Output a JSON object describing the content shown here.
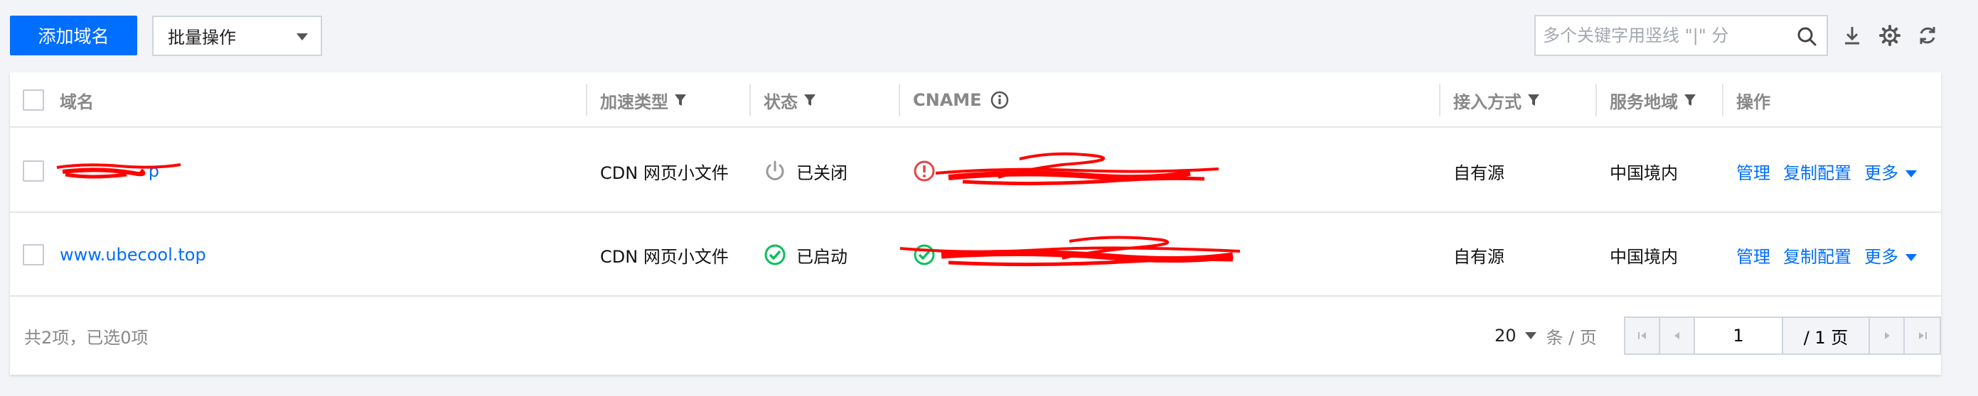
{
  "toolbar": {
    "add_domain_label": "添加域名",
    "batch_label": "批量操作",
    "search_placeholder": "多个关键字用竖线 \"|\" 分",
    "icons": [
      "download-icon",
      "gear-icon",
      "refresh-icon"
    ]
  },
  "table": {
    "columns": [
      "域名",
      "加速类型",
      "状态",
      "CNAME",
      "接入方式",
      "服务地域",
      "操作"
    ],
    "filterable_columns": [
      "加速类型",
      "状态",
      "接入方式",
      "服务地域"
    ],
    "rows": [
      {
        "domain": "",
        "domain_visible_suffix": "p",
        "type": "CDN 网页小文件",
        "status": "已关闭",
        "status_icon": "power-off-icon",
        "cname_icon": "alert-circle-icon",
        "access": "自有源",
        "region": "中国境内",
        "actions": [
          "管理",
          "复制配置",
          "更多"
        ]
      },
      {
        "domain": "www.ubecool.top",
        "type": "CDN 网页小文件",
        "status": "已启动",
        "status_icon": "check-circle-icon",
        "cname_icon": "check-circle-icon",
        "access": "自有源",
        "region": "中国境内",
        "actions": [
          "管理",
          "复制配置",
          "更多"
        ]
      }
    ]
  },
  "footer": {
    "summary": "共2项，已选0项",
    "page_size": "20",
    "page_size_unit": "条 / 页",
    "current_page": "1",
    "total_pages": "/ 1 页"
  },
  "colors": {
    "primary": "#006eff",
    "success": "#0abf5b",
    "error": "#e54545",
    "redaction": "#ff0000"
  }
}
